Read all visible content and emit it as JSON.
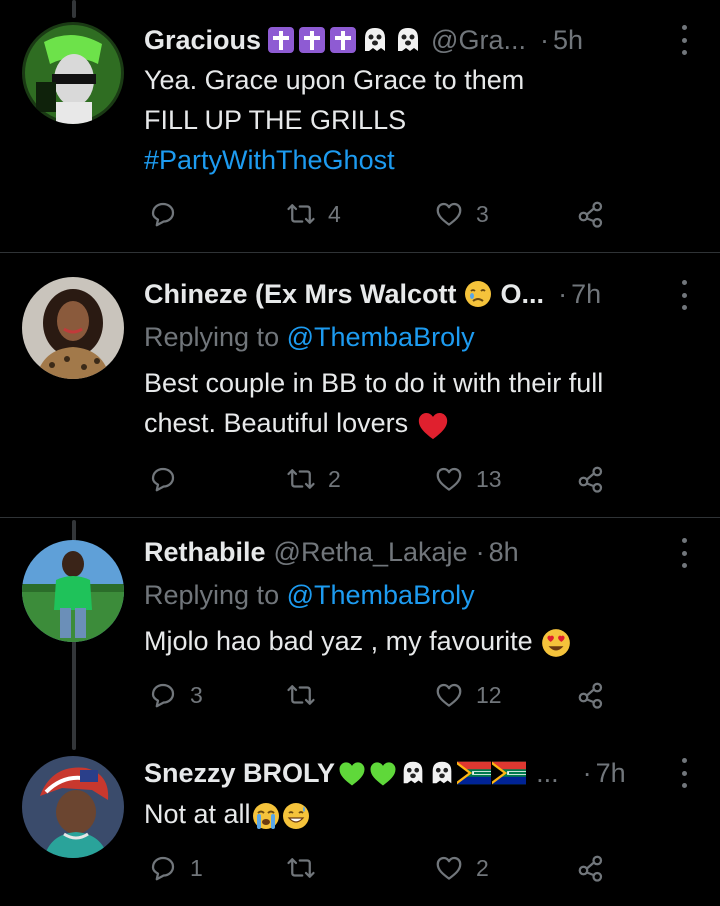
{
  "tweets": [
    {
      "name": "Gracious",
      "name_emojis": [
        "latin-cross-emoji",
        "latin-cross-emoji",
        "latin-cross-emoji",
        "ghost-emoji",
        "ghost-emoji"
      ],
      "handle": "@Gra...",
      "dot": "·",
      "time": "5h",
      "lines": [
        "Yea. Grace upon Grace to them",
        "FILL UP THE GRILLS"
      ],
      "hashtag": "#PartyWithTheGhost",
      "replies": "",
      "retweets": "4",
      "likes": "3"
    },
    {
      "name": "Chineze (Ex Mrs Walcott",
      "name_emojis": [
        "crying-face-emoji"
      ],
      "name_suffix": "O...",
      "dot": "·",
      "time": "7h",
      "replying_prefix": "Replying to",
      "replying_to": "@ThembaBroly",
      "lines": [
        "Best couple in BB to do it with their full",
        "chest. Beautiful lovers"
      ],
      "trailing_emoji": "red-heart-emoji",
      "replies": "",
      "retweets": "2",
      "likes": "13"
    },
    {
      "name": "Rethabile",
      "handle": "@Retha_Lakaje",
      "dot": "·",
      "time": "8h",
      "replying_prefix": "Replying to",
      "replying_to": "@ThembaBroly",
      "lines": [
        "Mjolo hao bad yaz , my favourite"
      ],
      "trailing_emoji": "heart-eyes-emoji",
      "replies": "3",
      "retweets": "",
      "likes": "12"
    },
    {
      "name": "Snezzy BROLY",
      "name_emojis": [
        "green-heart-emoji",
        "green-heart-emoji",
        "ghost-emoji",
        "ghost-emoji",
        "south-africa-flag-emoji",
        "south-africa-flag-emoji"
      ],
      "name_suffix": "...",
      "dot": "·",
      "time": "7h",
      "lines": [
        "Not at all"
      ],
      "trailing_emojis": [
        "loudly-crying-emoji",
        "grinning-sweat-emoji"
      ],
      "replies": "1",
      "retweets": "",
      "likes": "2"
    }
  ],
  "colors": {
    "background": "#000000",
    "text": "#e7e9ea",
    "muted": "#71767b",
    "link": "#1d9bf0",
    "divider": "#2f3336"
  }
}
